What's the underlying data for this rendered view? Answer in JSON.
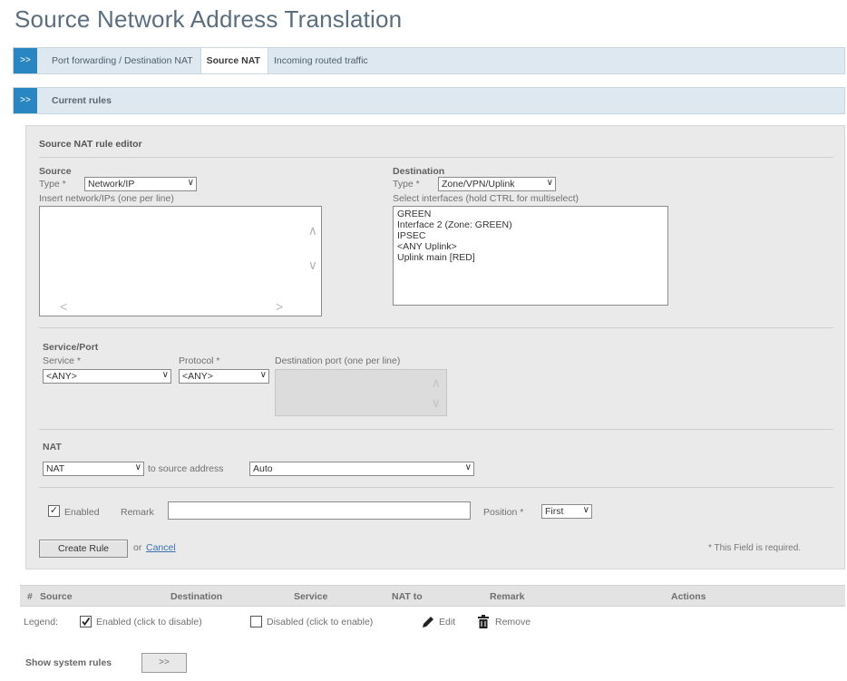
{
  "page": {
    "title": "Source Network Address Translation"
  },
  "tabs": {
    "toggle": ">>",
    "items": [
      {
        "label": "Port forwarding / Destination NAT",
        "active": false
      },
      {
        "label": "Source NAT",
        "active": true
      },
      {
        "label": "Incoming routed traffic",
        "active": false
      }
    ]
  },
  "rules_section": {
    "toggle": ">>",
    "label": "Current rules"
  },
  "editor": {
    "title": "Source NAT rule editor",
    "source": {
      "heading": "Source",
      "type_label": "Type *",
      "type_value": "Network/IP",
      "list_label": "Insert network/IPs (one per line)",
      "list_value": ""
    },
    "destination": {
      "heading": "Destination",
      "type_label": "Type *",
      "type_value": "Zone/VPN/Uplink",
      "list_label": "Select interfaces (hold CTRL for multiselect)",
      "options": [
        "GREEN",
        "Interface 2 (Zone: GREEN)",
        "IPSEC",
        "<ANY Uplink>",
        "Uplink main [RED]"
      ]
    },
    "service_port": {
      "heading": "Service/Port",
      "service_label": "Service *",
      "service_value": "<ANY>",
      "protocol_label": "Protocol *",
      "protocol_value": "<ANY>",
      "dest_port_label": "Destination port (one per line)"
    },
    "nat": {
      "heading": "NAT",
      "nat_value": "NAT",
      "to_source_label": "to source address",
      "source_address_value": "Auto"
    },
    "options": {
      "enabled_label": "Enabled",
      "enabled_checked": true,
      "remark_label": "Remark",
      "remark_value": "",
      "position_label": "Position *",
      "position_value": "First"
    },
    "actions": {
      "create_label": "Create Rule",
      "or_label": "or",
      "cancel_label": "Cancel",
      "required_note": "* This Field is required."
    }
  },
  "table": {
    "columns": [
      "#",
      "Source",
      "Destination",
      "Service",
      "NAT to",
      "Remark",
      "Actions"
    ]
  },
  "legend": {
    "label": "Legend:",
    "enabled": "Enabled (click to disable)",
    "disabled": "Disabled (click to enable)",
    "edit": "Edit",
    "remove": "Remove"
  },
  "system_rules": {
    "label": "Show system rules",
    "button": ">>"
  },
  "colors": {
    "accent": "#2a86c0",
    "bar_bg": "#dde8f1",
    "panel_bg": "#eaeaea",
    "link": "#3a6fb0"
  }
}
